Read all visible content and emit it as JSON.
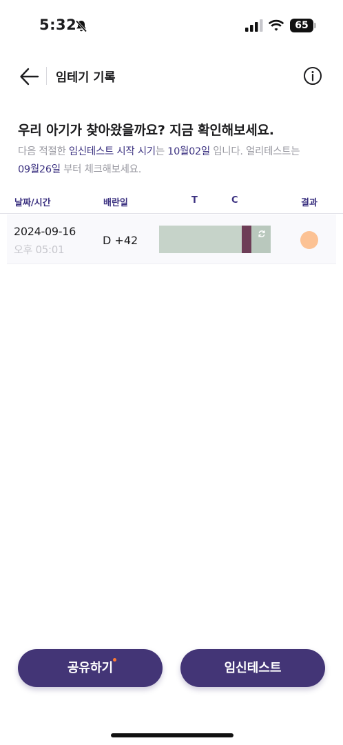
{
  "status_bar": {
    "time": "5:32",
    "battery": "65",
    "battery_level": 0.65
  },
  "header": {
    "title": "임테기 기록"
  },
  "intro": {
    "title": "우리 아기가 찾아왔을까요? 지금 확인해보세요.",
    "desc_1": "다음 적절한 ",
    "desc_hl_1": "임신테스트 시작 시기",
    "desc_2": "는 ",
    "desc_hl_2": "10월02일",
    "desc_3": " 입니다. 얼리테스트는 ",
    "desc_hl_3": "09월26일",
    "desc_4": " 부터 체크해보세요."
  },
  "table": {
    "headers": {
      "date": "날짜/시간",
      "ovulation": "배란일",
      "t": "T",
      "c": "C",
      "result": "결과"
    },
    "rows": [
      {
        "date": "2024-09-16",
        "time": "오후 05:01",
        "dday": "D +42",
        "result_color": "#fcc294"
      }
    ]
  },
  "buttons": {
    "share": "공유하기",
    "test": "임신테스트"
  },
  "colors": {
    "primary": "#433576",
    "accent_text": "#3b3180",
    "notification": "#ff7a30"
  }
}
